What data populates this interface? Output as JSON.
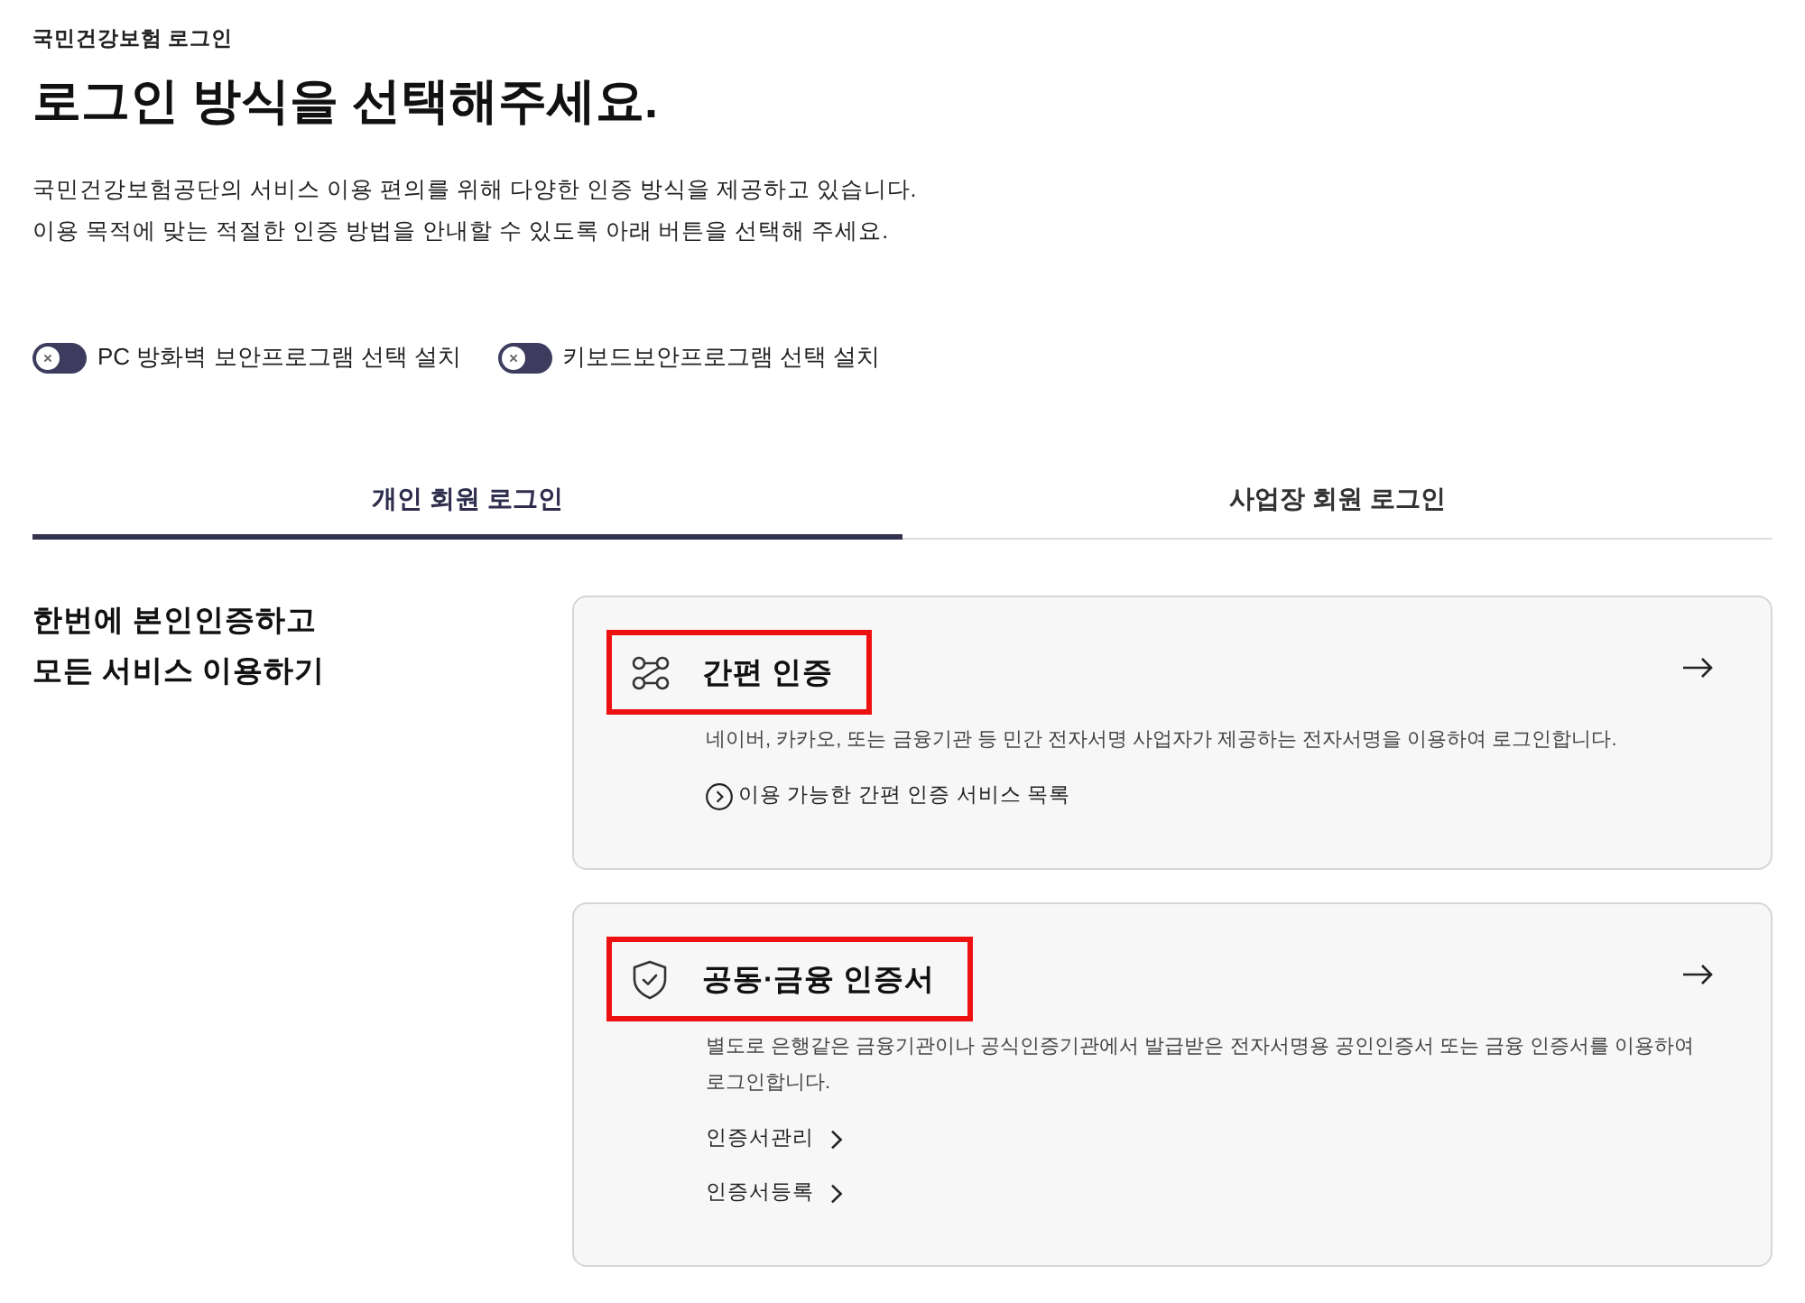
{
  "breadcrumb": "국민건강보험 로그인",
  "title": "로그인 방식을 선택해주세요.",
  "description": [
    "국민건강보험공단의 서비스 이용 편의를 위해 다양한 인증 방식을 제공하고 있습니다.",
    "이용 목적에 맞는 적절한 인증 방법을 안내할 수 있도록 아래 버튼을 선택해 주세요."
  ],
  "toggles": [
    {
      "label": "PC 방화벽 보안프로그램 선택 설치",
      "on": false
    },
    {
      "label": "키보드보안프로그램 선택 설치",
      "on": false
    }
  ],
  "tabs": [
    {
      "label": "개인 회원 로그인",
      "selected": true
    },
    {
      "label": "사업장 회원 로그인",
      "selected": false
    }
  ],
  "section_heading": [
    "한번에 본인인증하고",
    "모든 서비스 이용하기"
  ],
  "methods": [
    {
      "kind": "simple",
      "title": "간편 인증",
      "highlighted": true,
      "description": "네이버, 카카오, 또는 금융기관 등 민간 전자서명 사업자가 제공하는 전자서명을 이용하여 로그인합니다.",
      "links": [
        {
          "kind": "leading",
          "label": "이용 가능한 간편 인증 서비스 목록"
        }
      ]
    },
    {
      "kind": "certificate",
      "title": "공동·금융 인증서",
      "highlighted": true,
      "description": "별도로 은행같은 금융기관이나 공식인증기관에서 발급받은 전자서명용 공인인증서 또는 금융 인증서를 이용하여 로그인합니다.",
      "links": [
        {
          "kind": "trailing",
          "label": "인증서관리"
        },
        {
          "kind": "trailing",
          "label": "인증서등록"
        }
      ]
    }
  ]
}
